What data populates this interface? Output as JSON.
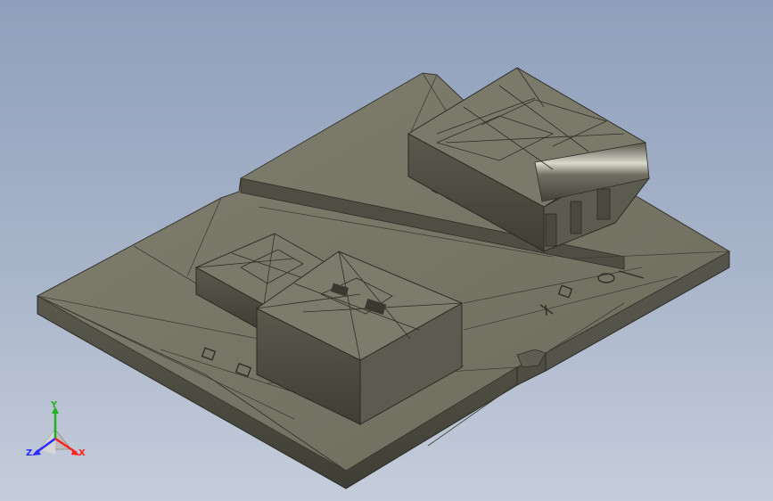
{
  "viewport": {
    "background_top": "#8fa0bc",
    "background_bottom": "#c5cddb",
    "model_color": "#757566"
  },
  "triad": {
    "axes": [
      {
        "name": "Y",
        "label": "Y",
        "color": "#1fb31f"
      },
      {
        "name": "Z",
        "label": "Z",
        "color": "#2b2bff"
      },
      {
        "name": "X",
        "label": "X",
        "color": "#ff2020"
      }
    ]
  }
}
